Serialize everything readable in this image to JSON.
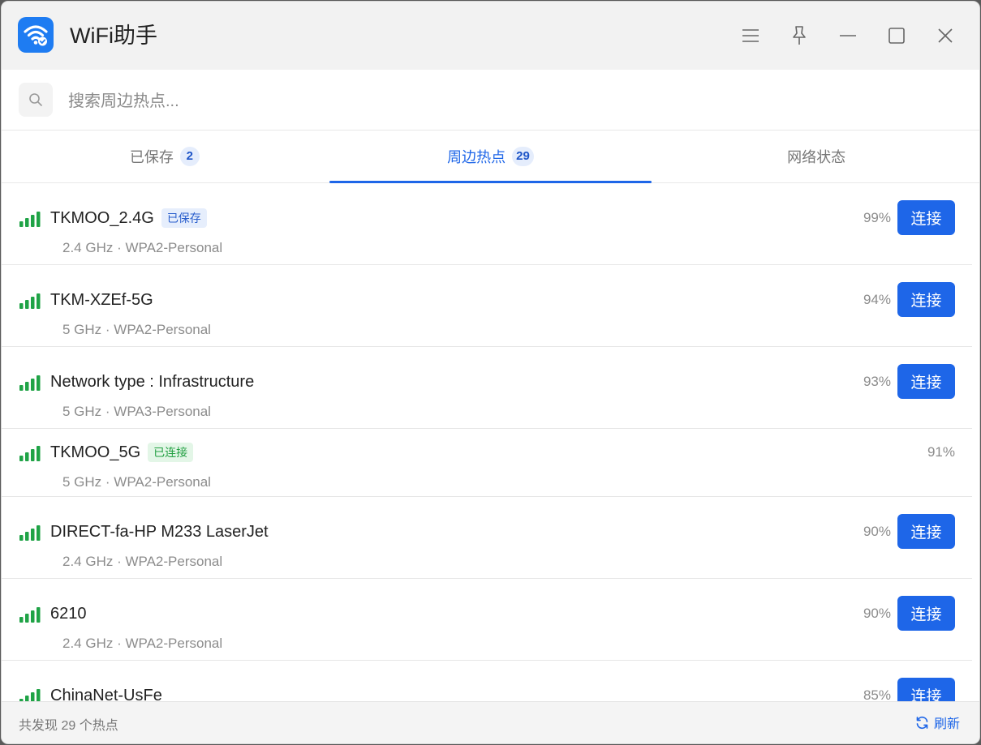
{
  "app": {
    "title": "WiFi助手",
    "accent_color": "#1e66e8",
    "icon": "wifi-check-icon"
  },
  "window_controls": {
    "menu": "menu-icon",
    "pin": "pin-icon",
    "minimize": "minimize-icon",
    "maximize": "maximize-icon",
    "close": "close-icon"
  },
  "search": {
    "placeholder": "搜索周边热点...",
    "value": ""
  },
  "tabs": [
    {
      "label": "已保存",
      "badge": "2",
      "active": false
    },
    {
      "label": "周边热点",
      "badge": "29",
      "active": true
    },
    {
      "label": "网络状态",
      "badge": "",
      "active": false
    }
  ],
  "networks": [
    {
      "ssid": "TKMOO_2.4G",
      "tag": "已保存",
      "tag_type": "saved",
      "details": "2.4 GHz · WPA2-Personal",
      "signal": "99%",
      "action": "连接"
    },
    {
      "ssid": "TKM-XZEf-5G",
      "tag": "",
      "tag_type": "",
      "details": "5 GHz · WPA2-Personal",
      "signal": "94%",
      "action": "连接"
    },
    {
      "ssid": "Network type : Infrastructure",
      "tag": "",
      "tag_type": "",
      "details": "5 GHz · WPA3-Personal",
      "signal": "93%",
      "action": "连接"
    },
    {
      "ssid": "TKMOO_5G",
      "tag": "已连接",
      "tag_type": "connected",
      "details": "5 GHz · WPA2-Personal",
      "signal": "91%",
      "action": ""
    },
    {
      "ssid": "DIRECT-fa-HP M233 LaserJet",
      "tag": "",
      "tag_type": "",
      "details": "2.4 GHz · WPA2-Personal",
      "signal": "90%",
      "action": "连接"
    },
    {
      "ssid": "6210",
      "tag": "",
      "tag_type": "",
      "details": "2.4 GHz · WPA2-Personal",
      "signal": "90%",
      "action": "连接"
    },
    {
      "ssid": "ChinaNet-UsFe",
      "tag": "",
      "tag_type": "",
      "details": "",
      "signal": "85%",
      "action": "连接"
    }
  ],
  "footer": {
    "count_text": "共发现 29 个热点",
    "refresh_label": "刷新"
  },
  "colors": {
    "signal_bars": "#1fa346",
    "connected_tag": "#23a043",
    "saved_tag": "#2a5fcc"
  }
}
